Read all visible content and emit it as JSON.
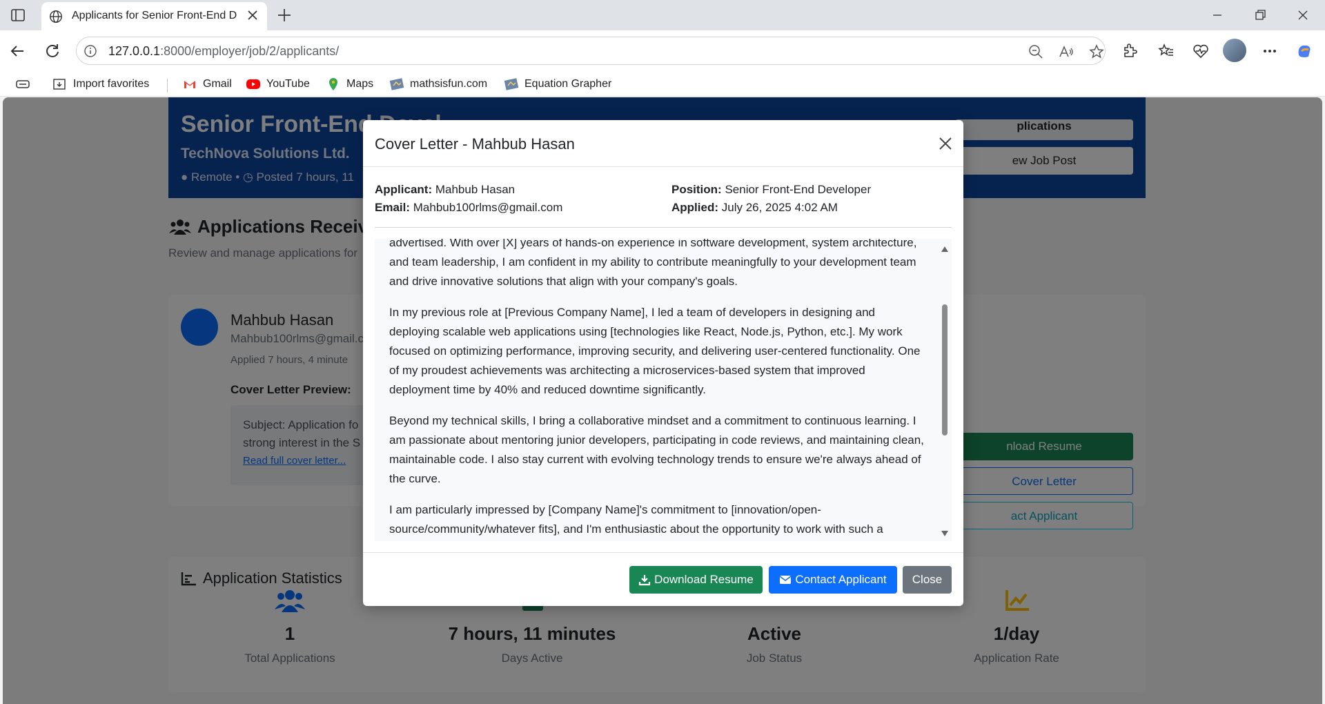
{
  "browser": {
    "tab_title": "Applicants for Senior Front-End D",
    "url_host": "127.0.0.1",
    "url_path": ":8000/employer/job/2/applicants/",
    "bookmarks": [
      "Import favorites",
      "Gmail",
      "YouTube",
      "Maps",
      "mathsisfun.com",
      "Equation Grapher"
    ]
  },
  "job": {
    "title": "Senior Front-End Devel",
    "company": "TechNova Solutions Ltd.",
    "meta_location": "Remote",
    "meta_posted": "Posted 7 hours, 11",
    "btn_applications": "plications",
    "btn_view_post": "ew Job Post"
  },
  "applications": {
    "heading": "Applications Receive",
    "subtitle": "Review and manage applications for"
  },
  "applicant_card": {
    "name": "Mahbub Hasan",
    "email": "Mahbub100rlms@gmail.c",
    "applied": "Applied 7 hours, 4 minute",
    "cover_label": "Cover Letter Preview:",
    "cover_line1": "Subject: Application fo",
    "cover_line2": "strong interest in the S",
    "read_more": "Read full cover letter...",
    "btn_download": "nload Resume",
    "btn_view_cover": "Cover Letter",
    "btn_contact": "act Applicant"
  },
  "stats": {
    "title": "Application Statistics",
    "items": [
      {
        "value": "1",
        "label": "Total Applications",
        "color": "#0d6efd"
      },
      {
        "value": "7 hours, 11 minutes",
        "label": "Days Active",
        "color": "#198754"
      },
      {
        "value": "Active",
        "label": "Job Status",
        "color": "#0dcaf0"
      },
      {
        "value": "1/day",
        "label": "Application Rate",
        "color": "#ffc107"
      }
    ]
  },
  "modal": {
    "title": "Cover Letter - Mahbub Hasan",
    "applicant_label": "Applicant:",
    "applicant_value": "Mahbub Hasan",
    "email_label": "Email:",
    "email_value": "Mahbub100rlms@gmail.com",
    "position_label": "Position:",
    "position_value": "Senior Front-End Developer",
    "applied_label": "Applied:",
    "applied_value": "July 26, 2025 4:02 AM",
    "paragraphs": [
      "advertised. With over [X] years of hands-on experience in software development, system architecture, and team leadership, I am confident in my ability to contribute meaningfully to your development team and drive innovative solutions that align with your company's goals.",
      "In my previous role at [Previous Company Name], I led a team of developers in designing and deploying scalable web applications using [technologies like React, Node.js, Python, etc.]. My work focused on optimizing performance, improving security, and delivering user-centered functionality. One of my proudest achievements was architecting a microservices-based system that improved deployment time by 40% and reduced downtime significantly.",
      "Beyond my technical skills, I bring a collaborative mindset and a commitment to continuous learning. I am passionate about mentoring junior developers, participating in code reviews, and maintaining clean, maintainable code. I also stay current with evolving technology trends to ensure we're always ahead of the curve.",
      "I am particularly impressed by [Company Name]'s commitment to [innovation/open-source/community/whatever fits], and I'm enthusiastic about the opportunity to work with such a"
    ],
    "btn_download": "Download Resume",
    "btn_contact": "Contact Applicant",
    "btn_close": "Close"
  }
}
